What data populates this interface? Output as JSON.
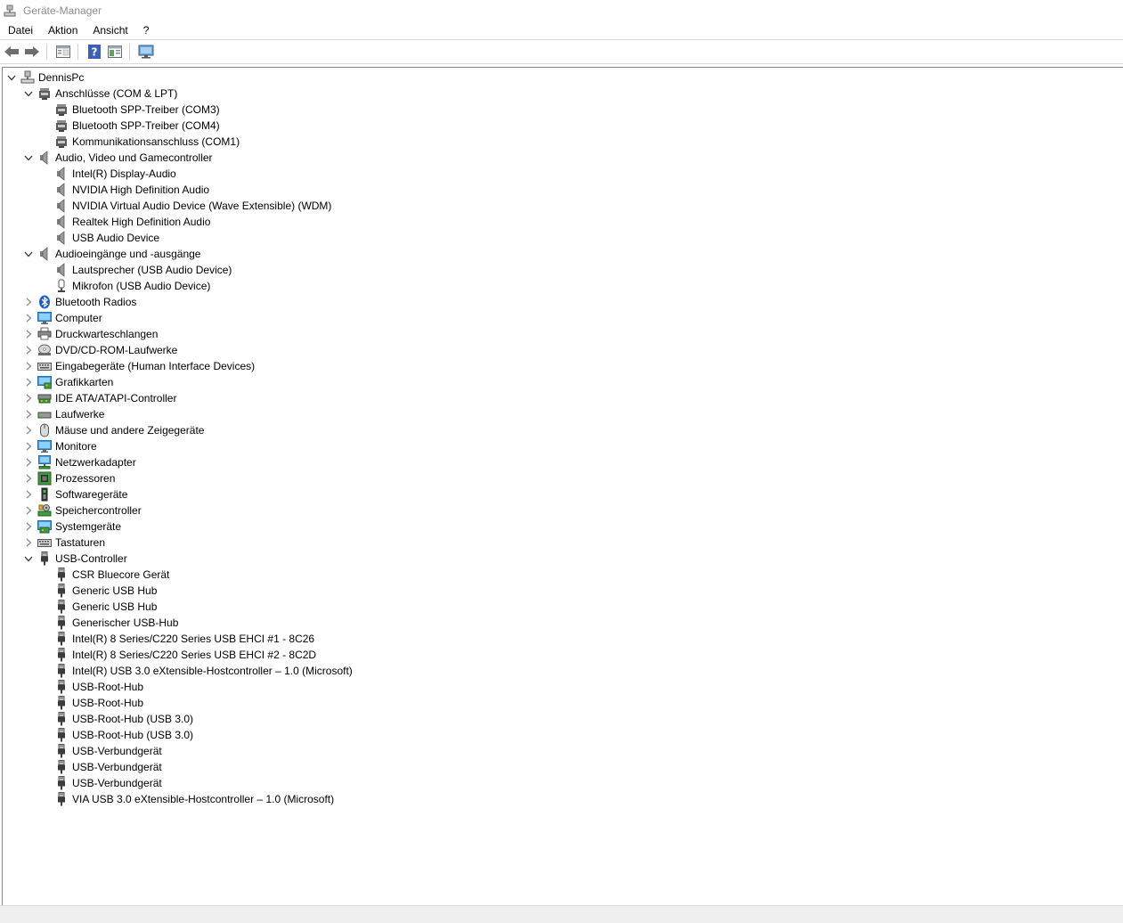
{
  "window": {
    "title": "Geräte-Manager"
  },
  "menu": [
    "Datei",
    "Aktion",
    "Ansicht",
    "?"
  ],
  "toolbar": [
    {
      "name": "back-button",
      "icon": "arrow-left-icon"
    },
    {
      "name": "forward-button",
      "icon": "arrow-right-icon"
    },
    {
      "name": "properties-button",
      "icon": "properties-icon"
    },
    {
      "name": "help-button",
      "icon": "help-icon"
    },
    {
      "name": "show-hidden-button",
      "icon": "show-panel-icon"
    },
    {
      "name": "scan-hardware-button",
      "icon": "monitor-scan-icon"
    }
  ],
  "colors": {
    "title_gray": "#8c8c8c",
    "pane_border": "#828790",
    "status_bg": "#f0f0f0"
  },
  "tree": [
    {
      "level": 0,
      "expander": "open",
      "icon": "computer-icon",
      "label": "DennisPc"
    },
    {
      "level": 1,
      "expander": "open",
      "icon": "port-icon",
      "label": "Anschlüsse (COM & LPT)"
    },
    {
      "level": 2,
      "expander": "none",
      "icon": "port-icon",
      "label": "Bluetooth SPP-Treiber (COM3)"
    },
    {
      "level": 2,
      "expander": "none",
      "icon": "port-icon",
      "label": "Bluetooth SPP-Treiber (COM4)"
    },
    {
      "level": 2,
      "expander": "none",
      "icon": "port-icon",
      "label": "Kommunikationsanschluss (COM1)"
    },
    {
      "level": 1,
      "expander": "open",
      "icon": "speaker-icon",
      "label": "Audio, Video und Gamecontroller"
    },
    {
      "level": 2,
      "expander": "none",
      "icon": "speaker-icon",
      "label": "Intel(R) Display-Audio"
    },
    {
      "level": 2,
      "expander": "none",
      "icon": "speaker-icon",
      "label": "NVIDIA High Definition Audio"
    },
    {
      "level": 2,
      "expander": "none",
      "icon": "speaker-icon",
      "label": "NVIDIA Virtual Audio Device (Wave Extensible) (WDM)"
    },
    {
      "level": 2,
      "expander": "none",
      "icon": "speaker-icon",
      "label": "Realtek High Definition Audio"
    },
    {
      "level": 2,
      "expander": "none",
      "icon": "speaker-icon",
      "label": "USB Audio Device"
    },
    {
      "level": 1,
      "expander": "open",
      "icon": "speaker-icon",
      "label": "Audioeingänge und -ausgänge"
    },
    {
      "level": 2,
      "expander": "none",
      "icon": "speaker-icon",
      "label": "Lautsprecher (USB Audio Device)"
    },
    {
      "level": 2,
      "expander": "none",
      "icon": "microphone-icon",
      "label": "Mikrofon (USB Audio Device)"
    },
    {
      "level": 1,
      "expander": "closed",
      "icon": "bluetooth-icon",
      "label": "Bluetooth Radios"
    },
    {
      "level": 1,
      "expander": "closed",
      "icon": "monitor-icon",
      "label": "Computer"
    },
    {
      "level": 1,
      "expander": "closed",
      "icon": "printer-icon",
      "label": "Druckwarteschlangen"
    },
    {
      "level": 1,
      "expander": "closed",
      "icon": "optical-drive-icon",
      "label": "DVD/CD-ROM-Laufwerke"
    },
    {
      "level": 1,
      "expander": "closed",
      "icon": "keyboard-icon",
      "label": "Eingabegeräte (Human Interface Devices)"
    },
    {
      "level": 1,
      "expander": "closed",
      "icon": "display-adapter-icon",
      "label": "Grafikkarten"
    },
    {
      "level": 1,
      "expander": "closed",
      "icon": "ide-controller-icon",
      "label": "IDE ATA/ATAPI-Controller"
    },
    {
      "level": 1,
      "expander": "closed",
      "icon": "disk-drive-icon",
      "label": "Laufwerke"
    },
    {
      "level": 1,
      "expander": "closed",
      "icon": "mouse-icon",
      "label": "Mäuse und andere Zeigegeräte"
    },
    {
      "level": 1,
      "expander": "closed",
      "icon": "monitor-icon",
      "label": "Monitore"
    },
    {
      "level": 1,
      "expander": "closed",
      "icon": "network-icon",
      "label": "Netzwerkadapter"
    },
    {
      "level": 1,
      "expander": "closed",
      "icon": "processor-icon",
      "label": "Prozessoren"
    },
    {
      "level": 1,
      "expander": "closed",
      "icon": "software-device-icon",
      "label": "Softwaregeräte"
    },
    {
      "level": 1,
      "expander": "closed",
      "icon": "storage-controller-icon",
      "label": "Speichercontroller"
    },
    {
      "level": 1,
      "expander": "closed",
      "icon": "system-device-icon",
      "label": "Systemgeräte"
    },
    {
      "level": 1,
      "expander": "closed",
      "icon": "keyboard-icon",
      "label": "Tastaturen"
    },
    {
      "level": 1,
      "expander": "open",
      "icon": "usb-icon",
      "label": "USB-Controller"
    },
    {
      "level": 2,
      "expander": "none",
      "icon": "usb-icon",
      "label": "CSR Bluecore Gerät"
    },
    {
      "level": 2,
      "expander": "none",
      "icon": "usb-icon",
      "label": "Generic USB Hub"
    },
    {
      "level": 2,
      "expander": "none",
      "icon": "usb-icon",
      "label": "Generic USB Hub"
    },
    {
      "level": 2,
      "expander": "none",
      "icon": "usb-icon",
      "label": "Generischer USB-Hub"
    },
    {
      "level": 2,
      "expander": "none",
      "icon": "usb-icon",
      "label": "Intel(R) 8 Series/C220 Series USB EHCI #1 - 8C26"
    },
    {
      "level": 2,
      "expander": "none",
      "icon": "usb-icon",
      "label": "Intel(R) 8 Series/C220 Series USB EHCI #2 - 8C2D"
    },
    {
      "level": 2,
      "expander": "none",
      "icon": "usb-icon",
      "label": "Intel(R) USB 3.0 eXtensible-Hostcontroller – 1.0 (Microsoft)"
    },
    {
      "level": 2,
      "expander": "none",
      "icon": "usb-icon",
      "label": "USB-Root-Hub"
    },
    {
      "level": 2,
      "expander": "none",
      "icon": "usb-icon",
      "label": "USB-Root-Hub"
    },
    {
      "level": 2,
      "expander": "none",
      "icon": "usb-icon",
      "label": "USB-Root-Hub (USB 3.0)"
    },
    {
      "level": 2,
      "expander": "none",
      "icon": "usb-icon",
      "label": "USB-Root-Hub (USB 3.0)"
    },
    {
      "level": 2,
      "expander": "none",
      "icon": "usb-icon",
      "label": "USB-Verbundgerät"
    },
    {
      "level": 2,
      "expander": "none",
      "icon": "usb-icon",
      "label": "USB-Verbundgerät"
    },
    {
      "level": 2,
      "expander": "none",
      "icon": "usb-icon",
      "label": "USB-Verbundgerät"
    },
    {
      "level": 2,
      "expander": "none",
      "icon": "usb-icon",
      "label": "VIA USB 3.0 eXtensible-Hostcontroller – 1.0 (Microsoft)"
    }
  ]
}
